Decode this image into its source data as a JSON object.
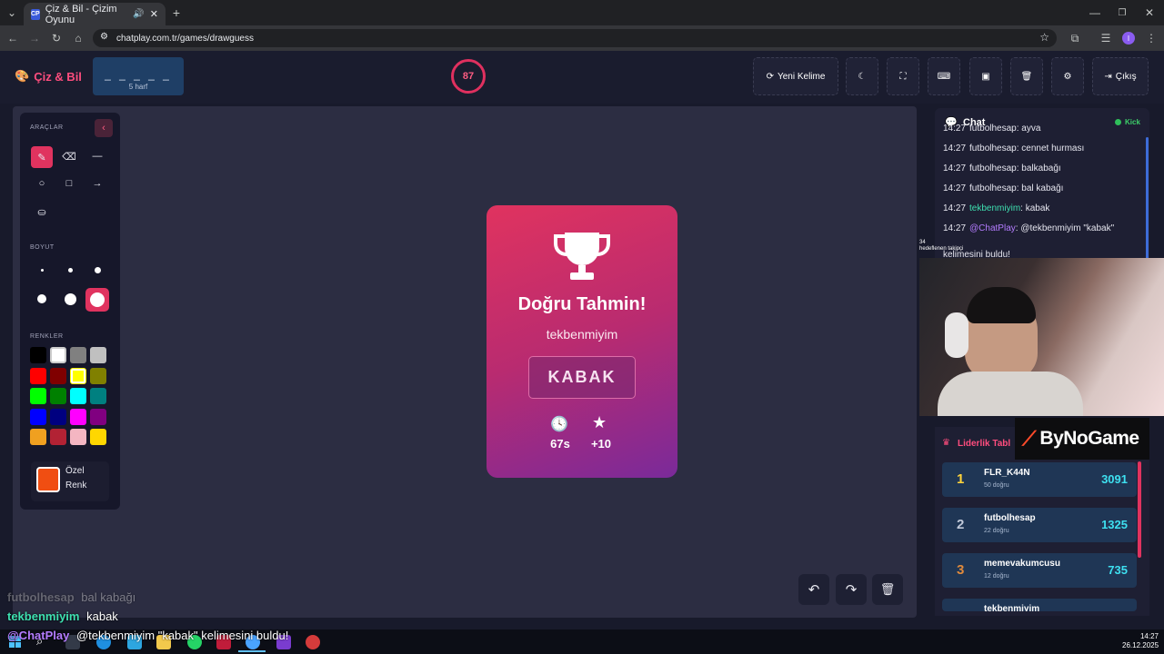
{
  "browser": {
    "tab_title": "Çiz & Bil - Çizim Oyunu",
    "tab_favicon": "CP",
    "url": "chatplay.com.tr/games/drawguess"
  },
  "header": {
    "logo": "Çiz & Bil",
    "word_blanks": "_ _ _ _ _",
    "word_count": "5 harf",
    "timer": "87",
    "new_word": "Yeni Kelime",
    "exit": "Çıkış"
  },
  "tools": {
    "title": "ARAÇLAR",
    "size_title": "BOYUT",
    "colors_title": "RENKLER",
    "custom_color_line1": "Özel",
    "custom_color_line2": "Renk",
    "custom_color": "#f04e12",
    "palette": [
      "#000000",
      "#ffffff",
      "#808080",
      "#c0c0c0",
      "#ff0000",
      "#800000",
      "#ffff00",
      "#808000",
      "#00ff00",
      "#008000",
      "#00ffff",
      "#008080",
      "#0000ff",
      "#000080",
      "#ff00ff",
      "#800080",
      "#f0a020",
      "#b22234",
      "#f4b6c2",
      "#ffd700"
    ]
  },
  "card": {
    "title": "Doğru Tahmin!",
    "player": "tekbenmiyim",
    "word": "KABAK",
    "time": "67s",
    "points": "+10"
  },
  "chat": {
    "title": "Chat",
    "status": "Kick",
    "messages": [
      {
        "time": "14:27",
        "user": "futbolhesap",
        "text": ": ayva",
        "color": "#e6e6ef"
      },
      {
        "time": "14:27",
        "user": "futbolhesap",
        "text": ": cennet hurması",
        "color": "#e6e6ef"
      },
      {
        "time": "14:27",
        "user": "futbolhesap",
        "text": ": balkabağı",
        "color": "#e6e6ef"
      },
      {
        "time": "14:27",
        "user": "futbolhesap",
        "text": ": bal kabağı",
        "color": "#e6e6ef"
      },
      {
        "time": "14:27",
        "user": "tekbenmiyim",
        "text": ": kabak",
        "color": "#3ee0b0"
      },
      {
        "time": "14:27",
        "user": "@ChatPlay",
        "text": ": @tekbenmiyim \"kabak\"",
        "color": "#b47cff"
      }
    ],
    "message_overflow": "kelimesini buldu!"
  },
  "leaderboard": {
    "title": "Liderlik Tabl",
    "rows": [
      {
        "rank": "1",
        "name": "FLR_K44N",
        "sub": "50 doğru",
        "score": "3091",
        "rank_color": "#ffd43b"
      },
      {
        "rank": "2",
        "name": "futbolhesap",
        "sub": "22 doğru",
        "score": "1325",
        "rank_color": "#c0c8d8"
      },
      {
        "rank": "3",
        "name": "memevakumcusu",
        "sub": "12 doğru",
        "score": "735",
        "rank_color": "#e08a3c"
      },
      {
        "rank": "",
        "name": "tekbenmiyim",
        "sub": "",
        "score": "",
        "rank_color": "#c0c8d8"
      }
    ]
  },
  "overlay": {
    "brand": "ByNoGame",
    "line1_user": "futbolhesap",
    "line1_text": "bal kabağı",
    "line2_user": "tekbenmiyim",
    "line2_text": "kabak",
    "line3_user": "@ChatPlay",
    "line3_text": "@tekbenmiyim \"kabak\" kelimesini buldu!",
    "webcam_label": "hedeflenen takipçi",
    "webcam_count": "34"
  },
  "taskbar": {
    "time": "14:27",
    "date": "26.12.2025"
  }
}
